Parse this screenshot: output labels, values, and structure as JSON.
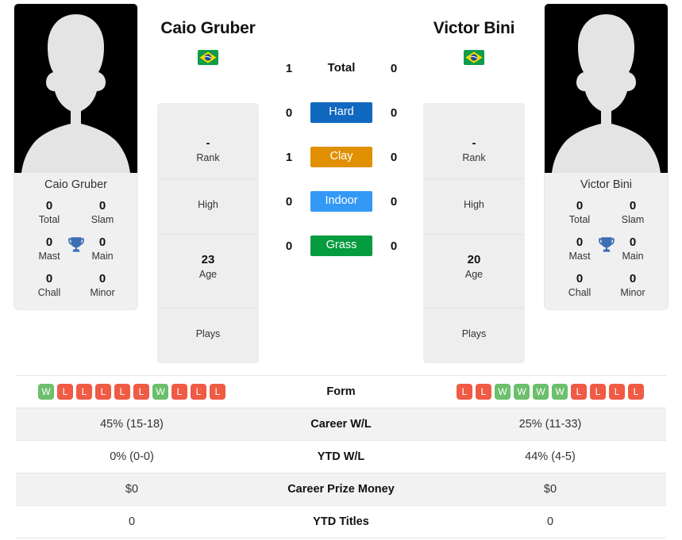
{
  "players": {
    "left": {
      "name": "Caio Gruber",
      "country_flag": "brazil-flag",
      "card_name": "Caio Gruber",
      "titles": {
        "total": {
          "value": "0",
          "label": "Total"
        },
        "slam": {
          "value": "0",
          "label": "Slam"
        },
        "mast": {
          "value": "0",
          "label": "Mast"
        },
        "main": {
          "value": "0",
          "label": "Main"
        },
        "chall": {
          "value": "0",
          "label": "Chall"
        },
        "minor": {
          "value": "0",
          "label": "Minor"
        }
      },
      "info": {
        "rank_value": "-",
        "rank_label": "Rank",
        "high_value": "",
        "high_label": "High",
        "age_value": "23",
        "age_label": "Age",
        "plays_value": "",
        "plays_label": "Plays"
      },
      "form": [
        "W",
        "L",
        "L",
        "L",
        "L",
        "L",
        "W",
        "L",
        "L",
        "L"
      ],
      "career_wl": "45% (15-18)",
      "ytd_wl": "0% (0-0)",
      "career_prize_money": "$0",
      "ytd_titles": "0"
    },
    "right": {
      "name": "Victor Bini",
      "country_flag": "brazil-flag",
      "card_name": "Victor Bini",
      "titles": {
        "total": {
          "value": "0",
          "label": "Total"
        },
        "slam": {
          "value": "0",
          "label": "Slam"
        },
        "mast": {
          "value": "0",
          "label": "Mast"
        },
        "main": {
          "value": "0",
          "label": "Main"
        },
        "chall": {
          "value": "0",
          "label": "Chall"
        },
        "minor": {
          "value": "0",
          "label": "Minor"
        }
      },
      "info": {
        "rank_value": "-",
        "rank_label": "Rank",
        "high_value": "",
        "high_label": "High",
        "age_value": "20",
        "age_label": "Age",
        "plays_value": "",
        "plays_label": "Plays"
      },
      "form": [
        "L",
        "L",
        "W",
        "W",
        "W",
        "W",
        "L",
        "L",
        "L",
        "L"
      ],
      "career_wl": "25% (11-33)",
      "ytd_wl": "44% (4-5)",
      "career_prize_money": "$0",
      "ytd_titles": "0"
    }
  },
  "head_to_head": {
    "total": {
      "label": "Total",
      "left": "1",
      "right": "0"
    },
    "surfaces": [
      {
        "label": "Hard",
        "left": "0",
        "right": "0",
        "color": "#1068c0"
      },
      {
        "label": "Clay",
        "left": "1",
        "right": "0",
        "color": "#e09000"
      },
      {
        "label": "Indoor",
        "left": "0",
        "right": "0",
        "color": "#3399f5"
      },
      {
        "label": "Grass",
        "left": "0",
        "right": "0",
        "color": "#059b3f"
      }
    ]
  },
  "stats_rows": {
    "form": {
      "label": "Form"
    },
    "career_wl": {
      "label": "Career W/L"
    },
    "ytd_wl": {
      "label": "YTD W/L"
    },
    "career_prize_money": {
      "label": "Career Prize Money"
    },
    "ytd_titles": {
      "label": "YTD Titles"
    }
  },
  "colors": {
    "win": "#6cbf6c",
    "loss": "#ef5b45",
    "trophy": "#3c6fb4",
    "card_bg": "#f0f0f0",
    "panel_bg": "#eeeeee"
  }
}
